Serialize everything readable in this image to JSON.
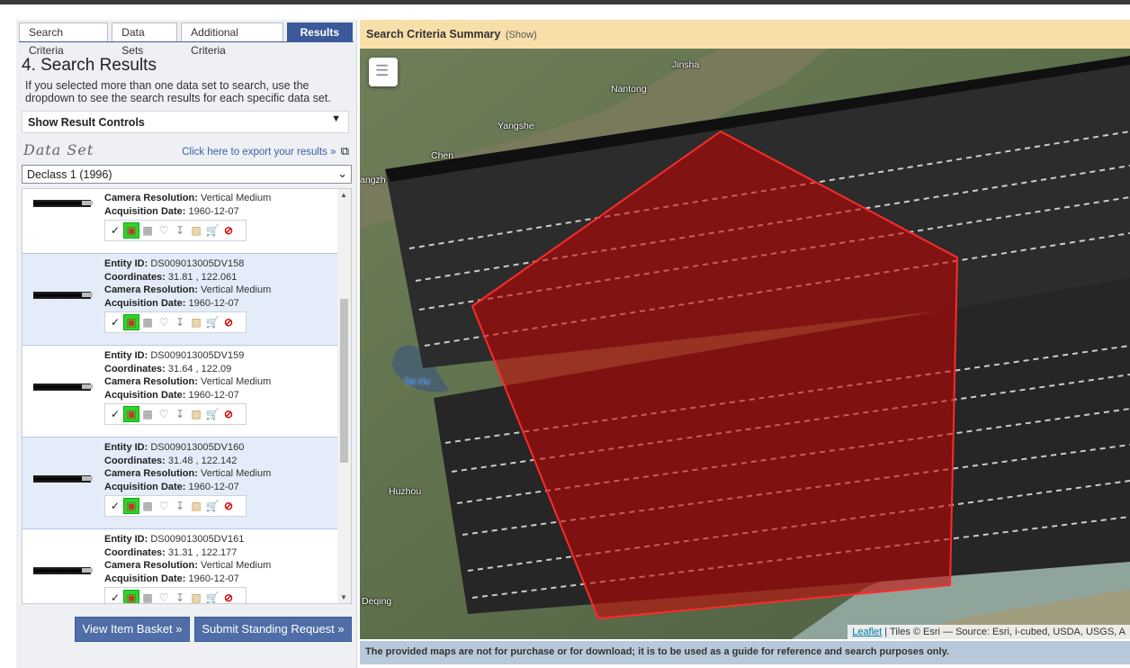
{
  "tabs": [
    {
      "label": "Search Criteria"
    },
    {
      "label": "Data Sets"
    },
    {
      "label": "Additional Criteria"
    },
    {
      "label": "Results"
    }
  ],
  "results": {
    "title": "4. Search Results",
    "description": "If you selected more than one data set to search, use the dropdown to see the search results for each specific data set.",
    "controls_label": "Show Result Controls",
    "dataset_label": "Data Set",
    "export_label": "Click here to export your results »",
    "dataset_selected": "Declass 1 (1996)"
  },
  "field_labels": {
    "entity": "Entity ID:",
    "coords": "Coordinates:",
    "camera": "Camera Resolution:",
    "date": "Acquisition Date:"
  },
  "items": [
    {
      "entity": "",
      "coords": "",
      "camera": "Vertical Medium",
      "date": "1960-12-07"
    },
    {
      "entity": "DS009013005DV158",
      "coords": "31.81 , 122.061",
      "camera": "Vertical Medium",
      "date": "1960-12-07"
    },
    {
      "entity": "DS009013005DV159",
      "coords": "31.64 , 122.09",
      "camera": "Vertical Medium",
      "date": "1960-12-07"
    },
    {
      "entity": "DS009013005DV160",
      "coords": "31.48 , 122.142",
      "camera": "Vertical Medium",
      "date": "1960-12-07"
    },
    {
      "entity": "DS009013005DV161",
      "coords": "31.31 , 122.177",
      "camera": "Vertical Medium",
      "date": "1960-12-07"
    }
  ],
  "item_icons": [
    "footprint-icon",
    "overlay-icon",
    "browse-icon",
    "compare-icon",
    "download-icon",
    "bulk-order-icon",
    "order-icon",
    "exclude-icon"
  ],
  "buttons": {
    "basket": "View Item Basket »",
    "standing": "Submit Standing Request »"
  },
  "summary": {
    "title": "Search Criteria Summary",
    "show": "(Show)"
  },
  "map": {
    "places": [
      {
        "name": "Jinsha"
      },
      {
        "name": "Nantong"
      },
      {
        "name": "Yangshe"
      },
      {
        "name": "Chen"
      },
      {
        "name": "angzh"
      },
      {
        "name": "Tai Hu"
      },
      {
        "name": "Huzhou"
      },
      {
        "name": "Deqing"
      }
    ],
    "attribution_link": "Leaflet",
    "attribution_text": " | Tiles © Esri — Source: Esri, i-cubed, USDA, USGS, A",
    "polygon_color": "#c80000"
  },
  "disclaimer": "The provided maps are not for purchase or for download; it is to be used as a guide for reference and search purposes only."
}
